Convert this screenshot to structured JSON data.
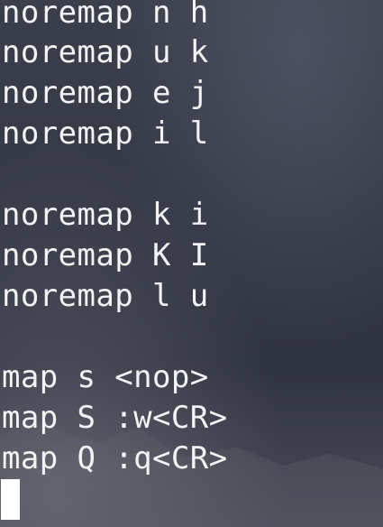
{
  "terminal": {
    "lines": [
      "noremap n h",
      "noremap u k",
      "noremap e j",
      "noremap i l",
      "",
      "noremap k i",
      "noremap K I",
      "noremap l u",
      "",
      "map s <nop>",
      "map S :w<CR>",
      "map Q :q<CR>"
    ],
    "cursor": "block"
  }
}
